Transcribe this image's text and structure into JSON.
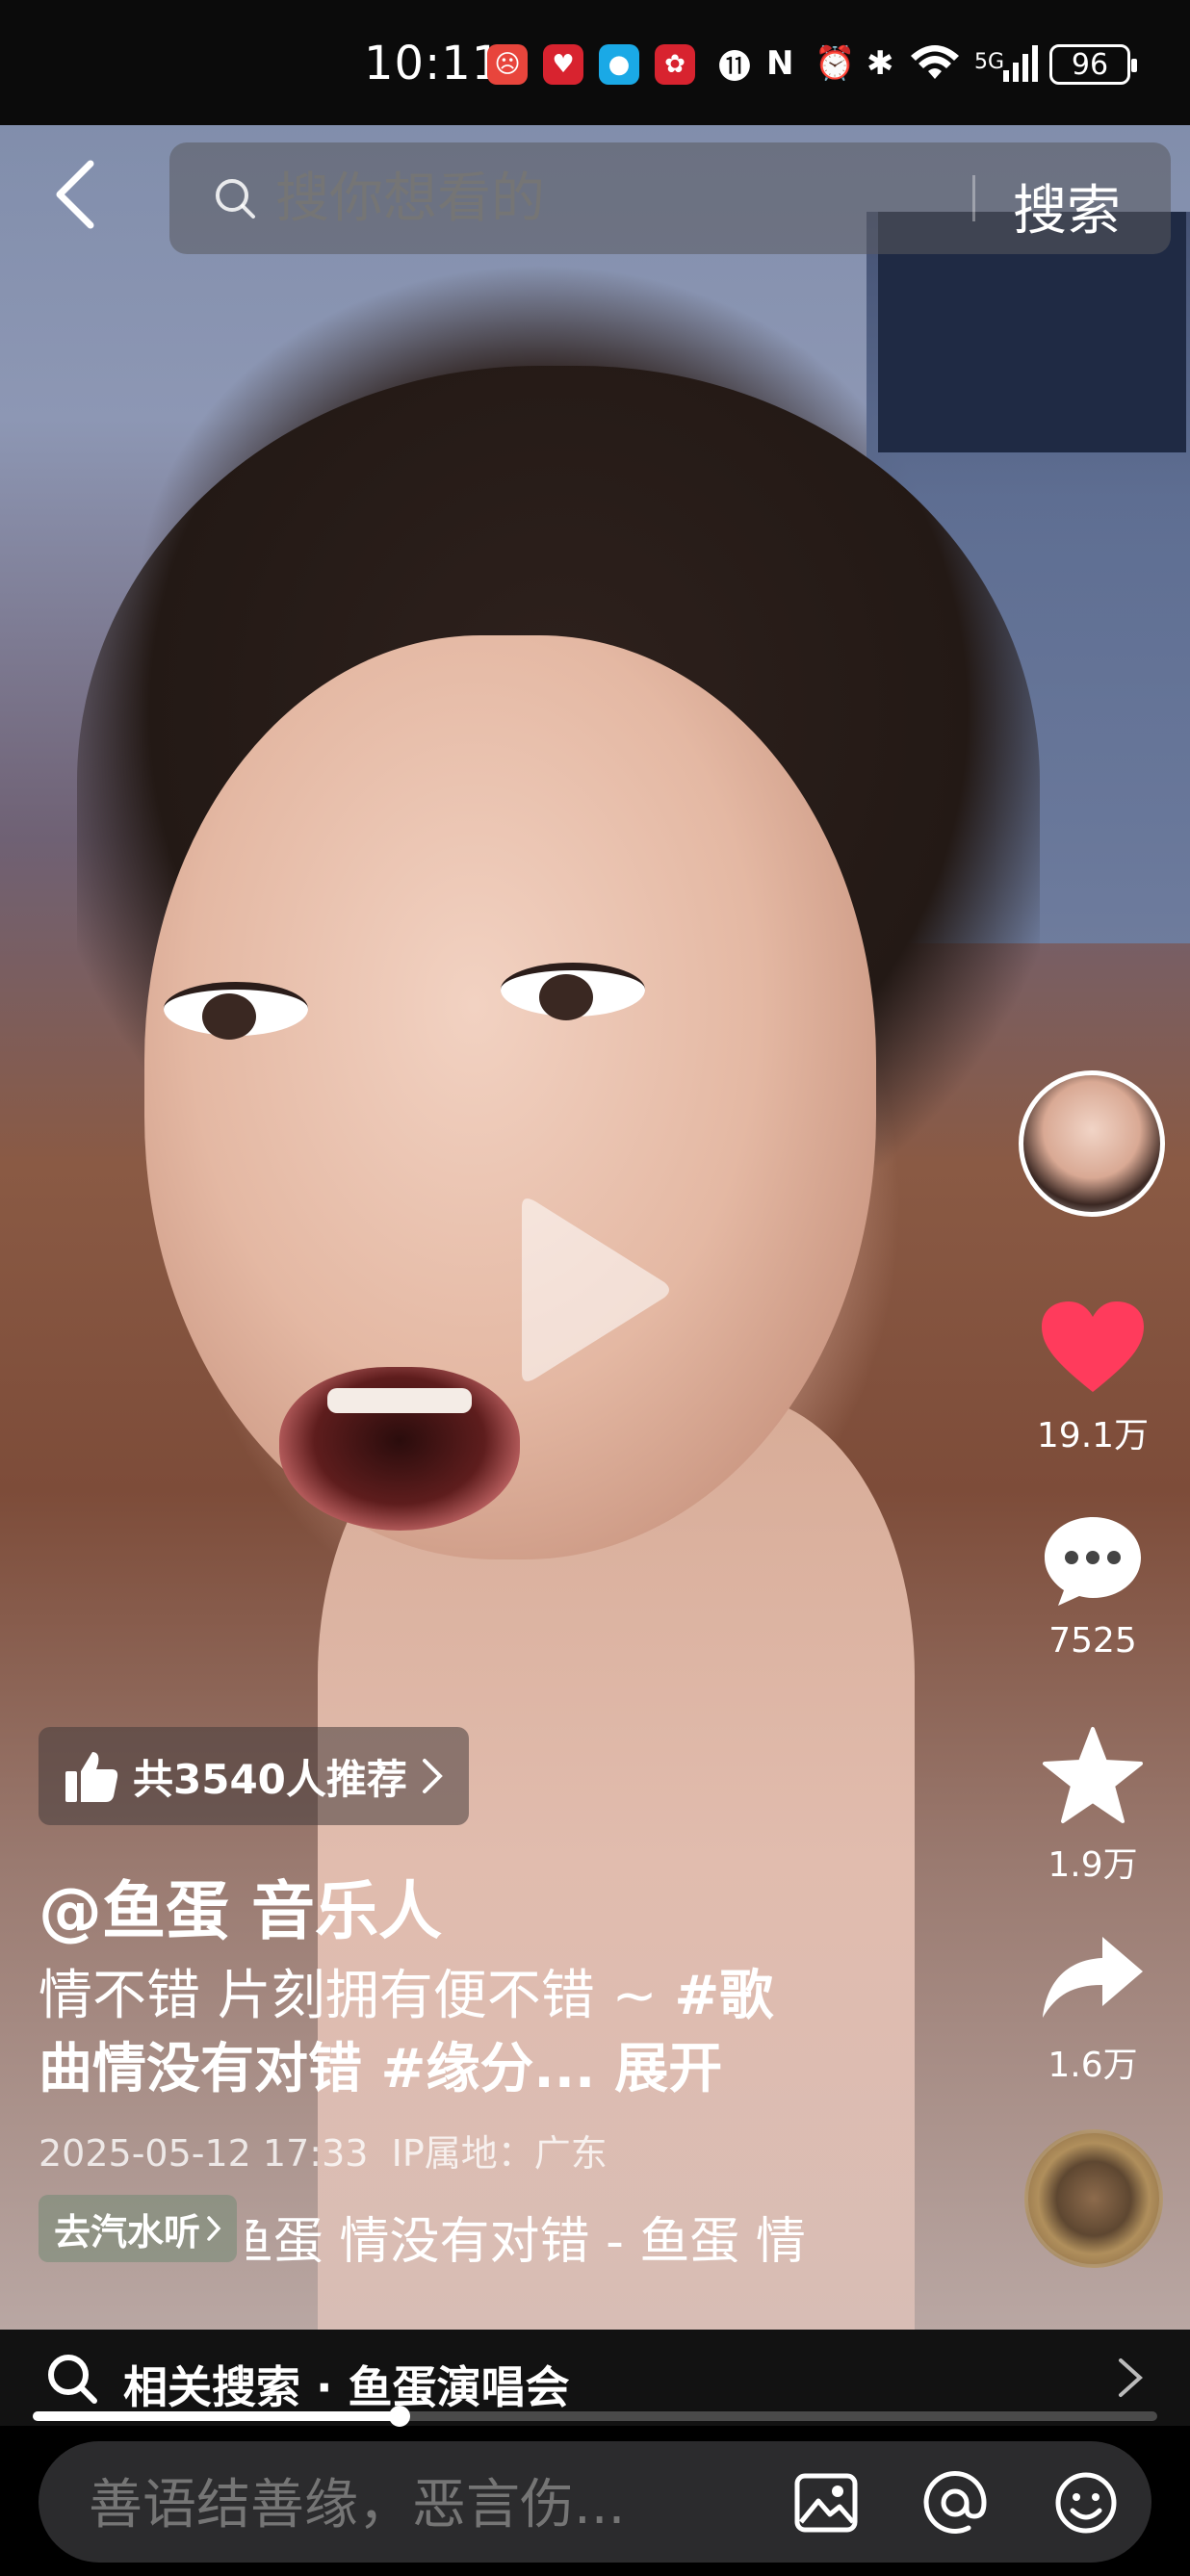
{
  "status_bar": {
    "time": "10:11",
    "battery": "96",
    "network": "5G"
  },
  "search": {
    "placeholder": "搜你想看的",
    "button": "搜索"
  },
  "video": {
    "recommend_text": "共3540人推荐",
    "author": "@鱼蛋 音乐人",
    "caption_text": "情不错 片刻拥有便不错 ~ ",
    "caption_tags_1": "#歌",
    "caption_line2": "曲情没有对错 #缘分...",
    "expand": "展开",
    "date": "2025-05-12 17:33",
    "ip": "IP属地：广东",
    "music_chip": "去汽水听",
    "music_title": "鱼蛋    情没有对错 - 鱼蛋    情"
  },
  "actions": {
    "likes": "19.1万",
    "comments": "7525",
    "favorites": "1.9万",
    "shares": "1.6万"
  },
  "related": {
    "label": "相关搜索 · 鱼蛋演唱会"
  },
  "progress": {
    "fraction": 0.326
  },
  "comment": {
    "placeholder": "善语结善缘，恶言伤..."
  },
  "colors": {
    "like": "#ff3b5c",
    "accent": "#ffffff"
  }
}
